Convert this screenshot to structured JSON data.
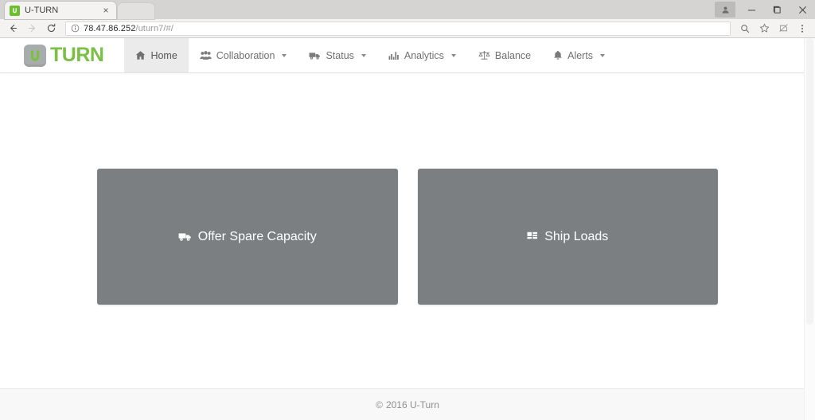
{
  "browser": {
    "tab": {
      "title": "U-TURN",
      "favicon": "uturn-favicon",
      "close_label": "×"
    },
    "window_controls": {
      "profile": "profile-icon",
      "minimize": "−",
      "maximize": "❐",
      "close": "✕"
    },
    "toolbar": {
      "back": "back-arrow-icon",
      "forward": "forward-arrow-icon",
      "reload": "reload-icon",
      "site_info": "info-circle-icon",
      "url_domain": "78.47.86.252",
      "url_path": "/uturn7/#/",
      "url_full": "78.47.86.252/uturn7/#/",
      "zoom": "zoom-search-icon",
      "bookmark": "star-icon",
      "extension": "extension-icon",
      "menu": "three-dot-menu-icon"
    }
  },
  "app": {
    "brand": {
      "mark": "u-logo-icon",
      "text": "TURN",
      "color": "#7ac143"
    },
    "nav": [
      {
        "label": "Home",
        "icon": "home-icon",
        "caret": false,
        "active": true
      },
      {
        "label": "Collaboration",
        "icon": "users-icon",
        "caret": true,
        "active": false
      },
      {
        "label": "Status",
        "icon": "truck-icon",
        "caret": true,
        "active": false
      },
      {
        "label": "Analytics",
        "icon": "chart-icon",
        "caret": true,
        "active": false
      },
      {
        "label": "Balance",
        "icon": "scales-icon",
        "caret": false,
        "active": false
      },
      {
        "label": "Alerts",
        "icon": "bell-icon",
        "caret": true,
        "active": false
      }
    ],
    "cards": [
      {
        "label": "Offer Spare Capacity",
        "icon": "truck-icon",
        "color": "#7c7f82"
      },
      {
        "label": "Ship Loads",
        "icon": "grid-icon",
        "color": "#7c7f82"
      }
    ],
    "footer": {
      "copyright_symbol": "©",
      "text": "2016 U-Turn"
    }
  }
}
